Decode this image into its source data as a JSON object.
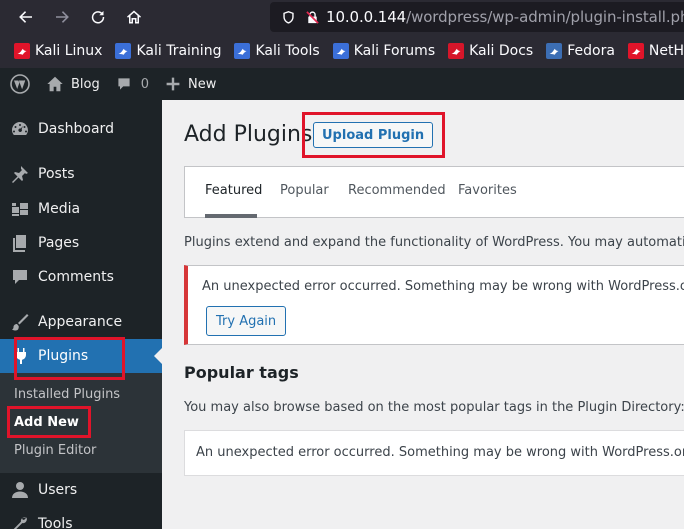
{
  "browser": {
    "url_host": "10.0.0.144",
    "url_path": "/wordpress/wp-admin/plugin-install.php",
    "bookmarks": [
      {
        "label": "Kali Linux",
        "icon": "kali-icon",
        "color": "#e0142a"
      },
      {
        "label": "Kali Training",
        "icon": "kali-training-icon",
        "color": "#3b6fd8"
      },
      {
        "label": "Kali Tools",
        "icon": "kali-tools-icon",
        "color": "#3b6fd8"
      },
      {
        "label": "Kali Forums",
        "icon": "kali-forums-icon",
        "color": "#3b6fd8"
      },
      {
        "label": "Kali Docs",
        "icon": "kali-docs-icon",
        "color": "#d6162a"
      },
      {
        "label": "Fedora",
        "icon": "fedora-icon",
        "color": "#3c6eb4"
      },
      {
        "label": "NetHunter",
        "icon": "nethunter-icon",
        "color": "#e0142a"
      }
    ]
  },
  "adminbar": {
    "site_name": "Blog",
    "comments_count": "0",
    "new_label": "New"
  },
  "sidebar": {
    "items": [
      {
        "label": "Dashboard",
        "icon": "dashboard-icon"
      },
      {
        "label": "Posts",
        "icon": "pin-icon"
      },
      {
        "label": "Media",
        "icon": "media-icon"
      },
      {
        "label": "Pages",
        "icon": "pages-icon"
      },
      {
        "label": "Comments",
        "icon": "comment-icon"
      },
      {
        "label": "Appearance",
        "icon": "brush-icon"
      },
      {
        "label": "Plugins",
        "icon": "plug-icon"
      },
      {
        "label": "Users",
        "icon": "user-icon"
      },
      {
        "label": "Tools",
        "icon": "wrench-icon"
      }
    ],
    "submenu": [
      "Installed Plugins",
      "Add New",
      "Plugin Editor"
    ]
  },
  "main": {
    "title": "Add Plugins",
    "upload_button": "Upload Plugin",
    "tabs": [
      "Featured",
      "Popular",
      "Recommended",
      "Favorites"
    ],
    "intro": "Plugins extend and expand the functionality of WordPress. You may automatically install",
    "error_text": "An unexpected error occurred. Something may be wrong with WordPress.org or this serve",
    "try_again": "Try Again",
    "popular_tags_title": "Popular tags",
    "popular_tags_intro": "You may also browse based on the most popular tags in the Plugin Directory:",
    "tags_error": "An unexpected error occurred. Something may be wrong with WordPress.org or this serve"
  },
  "colors": {
    "accent": "#2271b1",
    "error": "#d63638",
    "annotation": "#e0142a"
  }
}
